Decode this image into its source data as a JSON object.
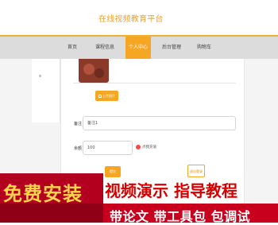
{
  "header": {
    "title": "在线视频教育平台"
  },
  "nav": {
    "items": [
      "首页",
      "课程信息",
      "个人中心",
      "后台管理",
      "购物车"
    ],
    "active_index": 2
  },
  "form": {
    "upload_label": "上传图片",
    "remark_label": "备注",
    "remark_value": "备注1",
    "balance_label": "余额",
    "balance_value": "100",
    "recharge_label": "点我充值",
    "submit_label": "提交",
    "reset_label": "退出登录"
  },
  "promo": {
    "main": "免费安装",
    "video": "视频演示 指导教程",
    "sub": "带论文 带工具包 包调试"
  },
  "colors": {
    "accent": "#f5a623",
    "nav_bg": "#dcdcdc",
    "promo_red": "#b3001e",
    "promo_yellow": "#ffd34a"
  }
}
